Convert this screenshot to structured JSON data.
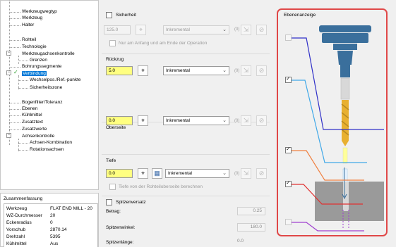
{
  "tree": {
    "items": [
      {
        "label": "Werkzeugwegtyp"
      },
      {
        "label": "Werkzeug"
      },
      {
        "label": "Halter"
      },
      {
        "label": "Rohteil"
      },
      {
        "label": "Technologie"
      },
      {
        "label": "Werkzeugachsenkontrolle"
      },
      {
        "label": "Grenzen"
      },
      {
        "label": "Bohrungssegmente"
      },
      {
        "label": "Verbindung"
      },
      {
        "label": "Wechselpos./Ref.-punkte"
      },
      {
        "label": "Sicherheitszone"
      },
      {
        "label": "Bogenfilter/Toleranz"
      },
      {
        "label": "Ebenen"
      },
      {
        "label": "Kühlmittel"
      },
      {
        "label": "Zusatztext"
      },
      {
        "label": "Zusatzwerte"
      },
      {
        "label": "Achsenkontrolle"
      },
      {
        "label": "Achsen-Kombination"
      },
      {
        "label": "Rotationsachsen"
      }
    ],
    "expander_minus": "−"
  },
  "summary": {
    "title": "Zusammenfassung",
    "rows": [
      {
        "key": "Werkzeug",
        "value": "FLAT END MILL - 20"
      },
      {
        "key": "WZ-Durchmesser",
        "value": "20"
      },
      {
        "key": "Eckenradius",
        "value": "0"
      },
      {
        "key": "Vorschub",
        "value": "2870.14"
      },
      {
        "key": "Drehzahl",
        "value": "5395"
      },
      {
        "key": "Kühlmittel",
        "value": "Aus"
      }
    ]
  },
  "sicherheit": {
    "label": "Sicherheit",
    "value": "125.0",
    "mode": "Inkremental",
    "hint": "(0)",
    "only_start_end": "Nur am Anfang und am Ende der Operation"
  },
  "rueckzug": {
    "label": "Rückzug",
    "value": "5.0",
    "mode": "Inkremental",
    "hint": "(0)"
  },
  "oberseite": {
    "label": "Oberseite",
    "value": "0.0",
    "mode": "Inkremental",
    "hint": "(0)"
  },
  "tiefe": {
    "label": "Tiefe",
    "value": "0.0",
    "mode": "Inkremental",
    "hint": "(0)",
    "calc_label": "Tiefe von der Rohteiloberseite berechnen"
  },
  "spitzenversatz": {
    "label": "Spitzenversatz",
    "betrag_label": "Betrag:",
    "betrag_value": "0.25",
    "winkel_label": "Spitzenwinkel:",
    "winkel_value": "180.0",
    "laenge_label": "Spitzenlänge:",
    "laenge_value": "0.0"
  },
  "layer_preview": {
    "title": "Ebenenanzeige",
    "colors": {
      "sicherheit": "#3030c8",
      "rueckzug": "#40a8e8",
      "oberseite": "#f08040",
      "tiefe": "#e03030",
      "spitze": "#a040d0",
      "tool_body": "#3a6f9c",
      "drill": "#e8b030",
      "stock": "#9a9a9a",
      "frame": "#e04848"
    }
  },
  "icons": {
    "crosshair": "⌖",
    "pick": "⇲",
    "reset": "⊘",
    "calc": "▦",
    "chevron": "⌄"
  }
}
